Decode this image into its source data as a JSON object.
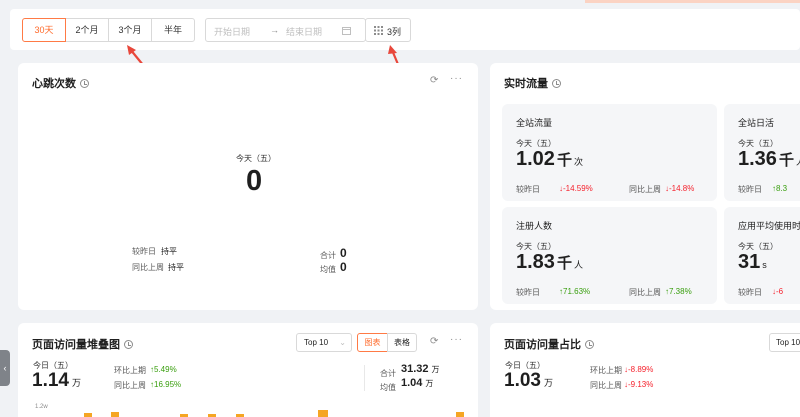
{
  "toolbar": {
    "periods": [
      "30天",
      "2个月",
      "3个月",
      "半年"
    ],
    "active_period": "30天",
    "start_placeholder": "开始日期",
    "end_placeholder": "结束日期",
    "range_separator": "→",
    "columns_label": "3列"
  },
  "heartbeat": {
    "title": "心跳次数",
    "day_label": "今天（五）",
    "value": "0",
    "vs_yesterday_label": "较昨日",
    "vs_yesterday_value": "持平",
    "vs_lastweek_label": "同比上周",
    "vs_lastweek_value": "持平",
    "total_label": "合计",
    "total_value": "0",
    "avg_label": "均值",
    "avg_value": "0"
  },
  "realtime": {
    "title": "实时流量",
    "tiles": [
      {
        "title": "全站流量",
        "day": "今天（五）",
        "value": "1.02",
        "unit": "千",
        "unit2": "次",
        "cmp1_label": "较昨日",
        "cmp1_value": "↓-14.59%",
        "cmp2_label": "同比上周",
        "cmp2_value": "↓-14.8%"
      },
      {
        "title": "全站日活",
        "day": "今天（五）",
        "value": "1.36",
        "unit": "千",
        "unit2": "人",
        "cmp1_label": "较昨日",
        "cmp1_value": "↑8.3"
      },
      {
        "title": "注册人数",
        "day": "今天（五）",
        "value": "1.83",
        "unit": "千",
        "unit2": "人",
        "cmp1_label": "较昨日",
        "cmp1_value": "↑71.63%",
        "cmp2_label": "同比上周",
        "cmp2_value": "↑7.38%"
      },
      {
        "title": "应用平均使用时",
        "day": "今天（五）",
        "value": "31",
        "unit": "s",
        "cmp1_label": "较昨日",
        "cmp1_value": "↓-6"
      }
    ]
  },
  "pv_stack": {
    "title": "页面访问量堆叠图",
    "top_select": "Top 10",
    "chart_btn": "图表",
    "table_btn": "表格",
    "day_label": "今日（五）",
    "value": "1.14",
    "unit": "万",
    "cmp1_label": "环比上期",
    "cmp1_value": "↑5.49%",
    "cmp2_label": "同比上周",
    "cmp2_value": "↑16.95%",
    "total_label": "合计",
    "total_value": "31.32",
    "total_unit": "万",
    "avg_label": "均值",
    "avg_value": "1.04",
    "avg_unit": "万",
    "axis_label": "1.2w"
  },
  "pv_share": {
    "title": "页面访问量占比",
    "top_select": "Top 10",
    "day_label": "今日（五）",
    "value": "1.03",
    "unit": "万",
    "cmp1_label": "环比上期",
    "cmp1_value": "↓-8.89%",
    "cmp2_label": "同比上周",
    "cmp2_value": "↓-9.13%"
  },
  "colors": {
    "accent": "#ff6a2a",
    "up": "#389e0d",
    "down": "#f5222d",
    "bars": "#f5a623"
  }
}
